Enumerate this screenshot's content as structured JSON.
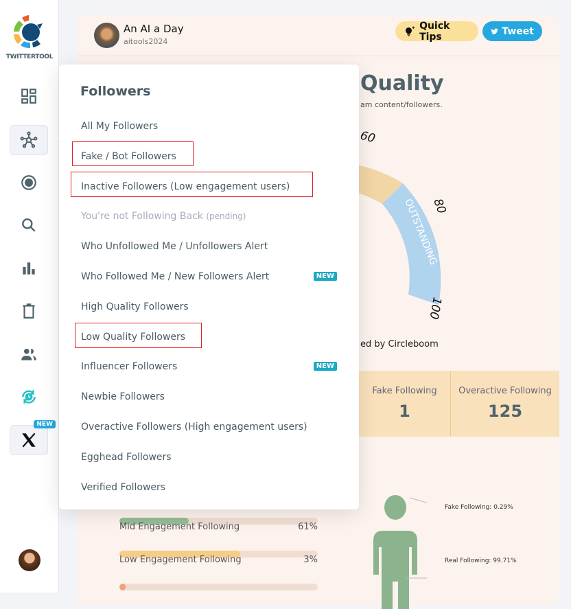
{
  "brand": {
    "name": "TWITTERTOOL"
  },
  "sidebar": {
    "items": [
      {
        "icon": "dashboard-icon"
      },
      {
        "icon": "network-icon",
        "active": true
      },
      {
        "icon": "record-icon"
      },
      {
        "icon": "search-icon"
      },
      {
        "icon": "bar-chart-icon"
      },
      {
        "icon": "trash-icon"
      },
      {
        "icon": "users-icon"
      },
      {
        "icon": "schedule-sync-icon"
      },
      {
        "icon": "x-logo-icon",
        "badge": "NEW"
      }
    ]
  },
  "header": {
    "user_name": "An AI a Day",
    "user_handle": "aitools2024",
    "quick_tips": "Quick Tips",
    "tweet": "Tweet"
  },
  "main": {
    "title": "Quality",
    "subtitle": "am content/followers.",
    "gauge": {
      "ticks": [
        "60",
        "80",
        "100"
      ],
      "band_label": "OUTSTANDING"
    },
    "powered": "ed by Circleboom"
  },
  "stats": [
    {
      "label": "Fake Following",
      "value": "1"
    },
    {
      "label": "Overactive Following",
      "value": "125"
    }
  ],
  "engagement": [
    {
      "label": "",
      "percent": "",
      "fill": 35,
      "color": "#97bb98"
    },
    {
      "label": "Mid Engagement Following",
      "percent": "61%",
      "fill": 61,
      "color": "#f6cd87"
    },
    {
      "label": "Low Engagement Following",
      "percent": "3%",
      "fill": 3,
      "color": "#f0a27c"
    }
  ],
  "figure": {
    "fake": "Fake Following: 0.29%",
    "real": "Real Following: 99.71%"
  },
  "menu": {
    "title": "Followers",
    "items": [
      {
        "label": "All My Followers"
      },
      {
        "label": "Fake / Bot Followers",
        "highlighted": true
      },
      {
        "label": "Inactive Followers (Low engagement users)",
        "highlighted": true
      },
      {
        "label": "You're not Following Back",
        "suffix": "(pending)",
        "disabled": true
      },
      {
        "label": "Who Unfollowed Me / Unfollowers Alert"
      },
      {
        "label": "Who Followed Me / New Followers Alert",
        "badge": "NEW"
      },
      {
        "label": "High Quality Followers"
      },
      {
        "label": "Low Quality Followers",
        "highlighted": true
      },
      {
        "label": "Influencer Followers",
        "badge": "NEW"
      },
      {
        "label": "Newbie Followers"
      },
      {
        "label": "Overactive Followers (High engagement users)"
      },
      {
        "label": "Egghead Followers"
      },
      {
        "label": "Verified Followers"
      }
    ]
  }
}
